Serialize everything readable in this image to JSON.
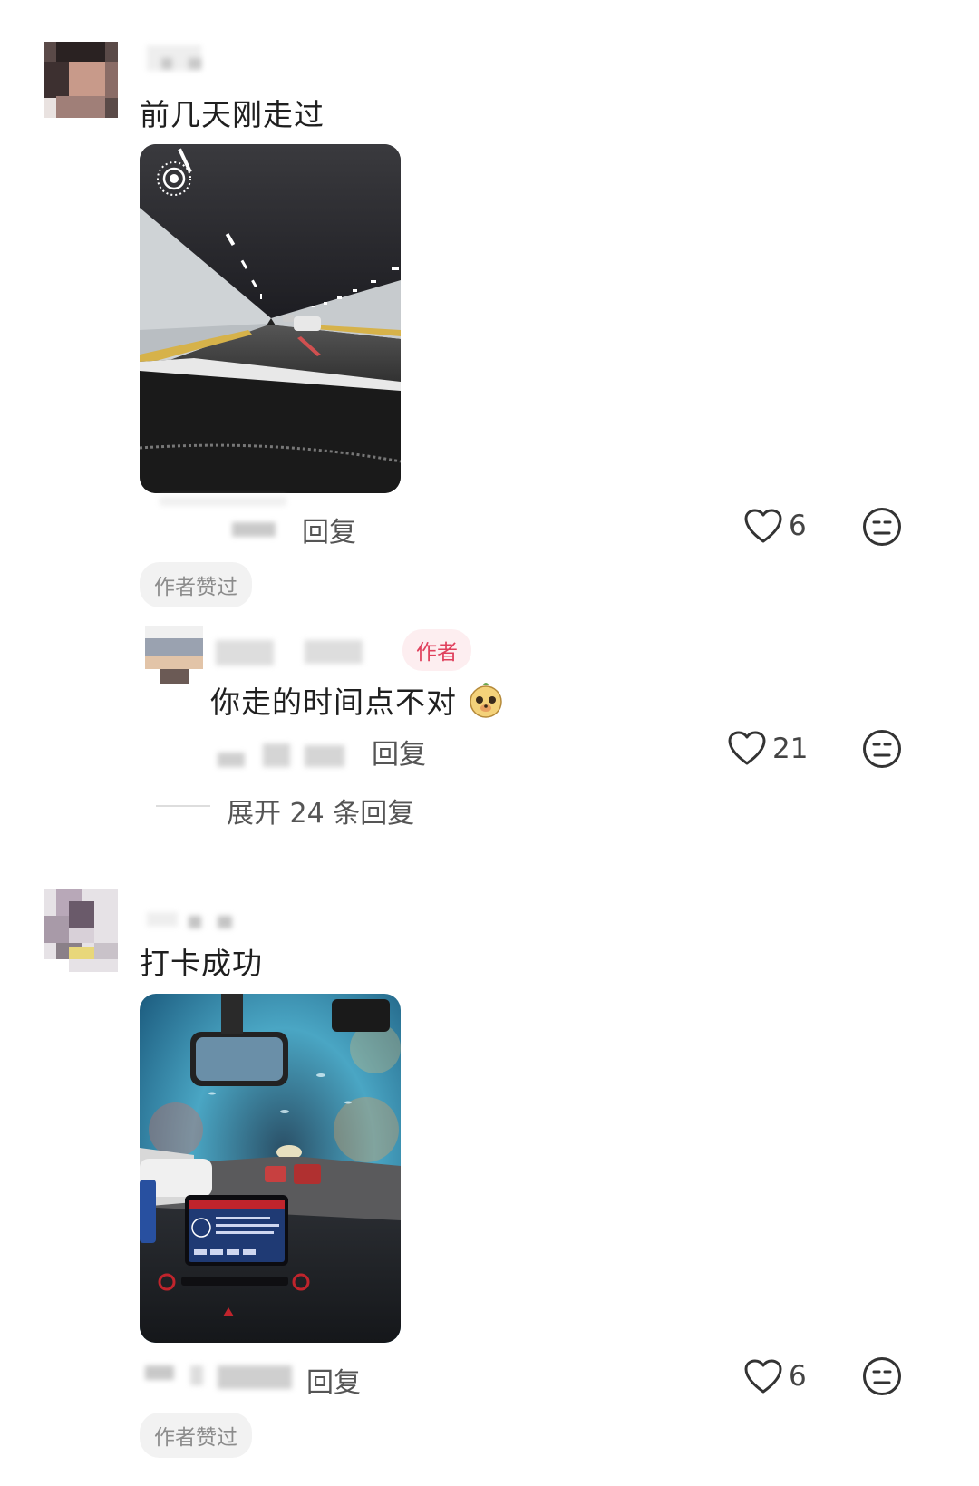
{
  "comments": [
    {
      "text": "前几天刚走过",
      "reply_label": "回复",
      "likes": "6",
      "author_liked_badge": "作者赞过",
      "replies": [
        {
          "author_badge": "作者",
          "text": "你走的时间点不对",
          "emoji_icon": "meerkat-emoji-icon",
          "reply_label": "回复",
          "likes": "21"
        }
      ],
      "expand_label": "展开 24 条回复"
    },
    {
      "text": "打卡成功",
      "reply_label": "回复",
      "likes": "6",
      "author_liked_badge": "作者赞过"
    }
  ],
  "icons": {
    "like": "heart-outline-icon",
    "dislike": "neutral-face-icon",
    "live_photo": "live-photo-icon"
  },
  "colors": {
    "author_badge_text": "#e0405c",
    "author_badge_bg": "#fdeef0",
    "meta_text": "#555555"
  }
}
